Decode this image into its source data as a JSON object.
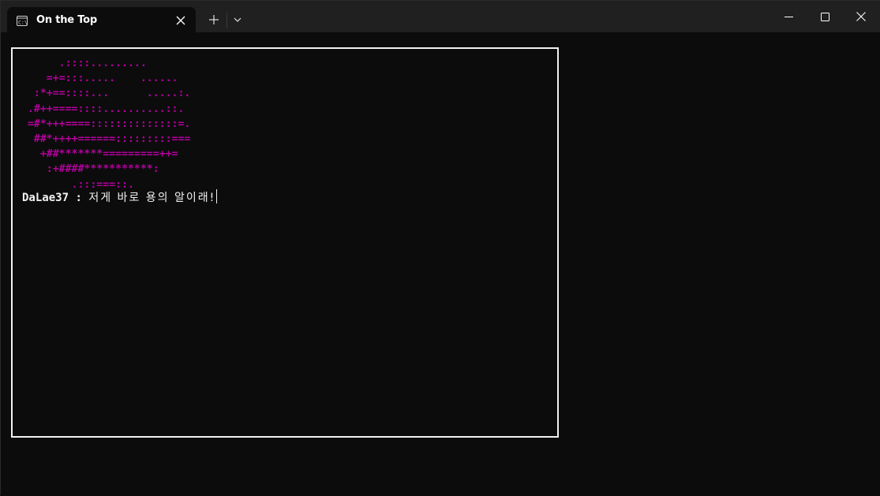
{
  "window": {
    "tab_title": "On the Top",
    "tab_icon": "terminal-icon",
    "controls": [
      "minimize-icon",
      "maximize-icon",
      "close-icon"
    ]
  },
  "terminal": {
    "art_color": "#b4009e",
    "art_lines": [
      "      .::::.........",
      "    =+=:::.....    ......",
      "  :*+==::::...      .....:.",
      " .#++====::::..........::.",
      " =#*+++====::::::::::::::=.",
      "  ##*++++======:::::::::===",
      "   +##*******=========++=",
      "    :+####***********:",
      "        .:::===::."
    ],
    "speaker": "DaLae37",
    "separator": " : ",
    "dialogue": "저게 바로 용의 알이래!"
  }
}
